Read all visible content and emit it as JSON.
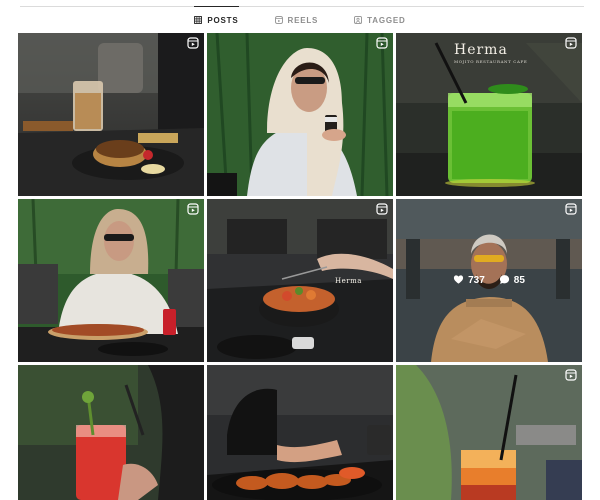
{
  "tabs": [
    {
      "label": "POSTS",
      "icon": "grid-icon",
      "active": true
    },
    {
      "label": "REELS",
      "icon": "reels-icon",
      "active": false
    },
    {
      "label": "TAGGED",
      "icon": "tagged-icon",
      "active": false
    }
  ],
  "colors": {
    "tab_active": "#262626",
    "tab_inactive": "#8e8e8e",
    "divider": "#dbdbdb"
  },
  "posts": [
    {
      "subject": "pancake dessert with coffee",
      "reel": true
    },
    {
      "subject": "woman in white headscarf holding drink",
      "reel": true
    },
    {
      "subject": "green iced drink",
      "reel": true,
      "brand": "Herma",
      "brand_sub": "MOJITO RESTAURANT CAFE"
    },
    {
      "subject": "woman eating pizza",
      "reel": true
    },
    {
      "subject": "salad bowl served on table",
      "reel": true,
      "brand": "Herma"
    },
    {
      "subject": "man with yellow sunglasses",
      "reel": true,
      "likes": "737",
      "comments": "85"
    },
    {
      "subject": "red iced drink",
      "reel": false
    },
    {
      "subject": "fried food platter",
      "reel": false
    },
    {
      "subject": "orange layered drink",
      "reel": true
    }
  ]
}
